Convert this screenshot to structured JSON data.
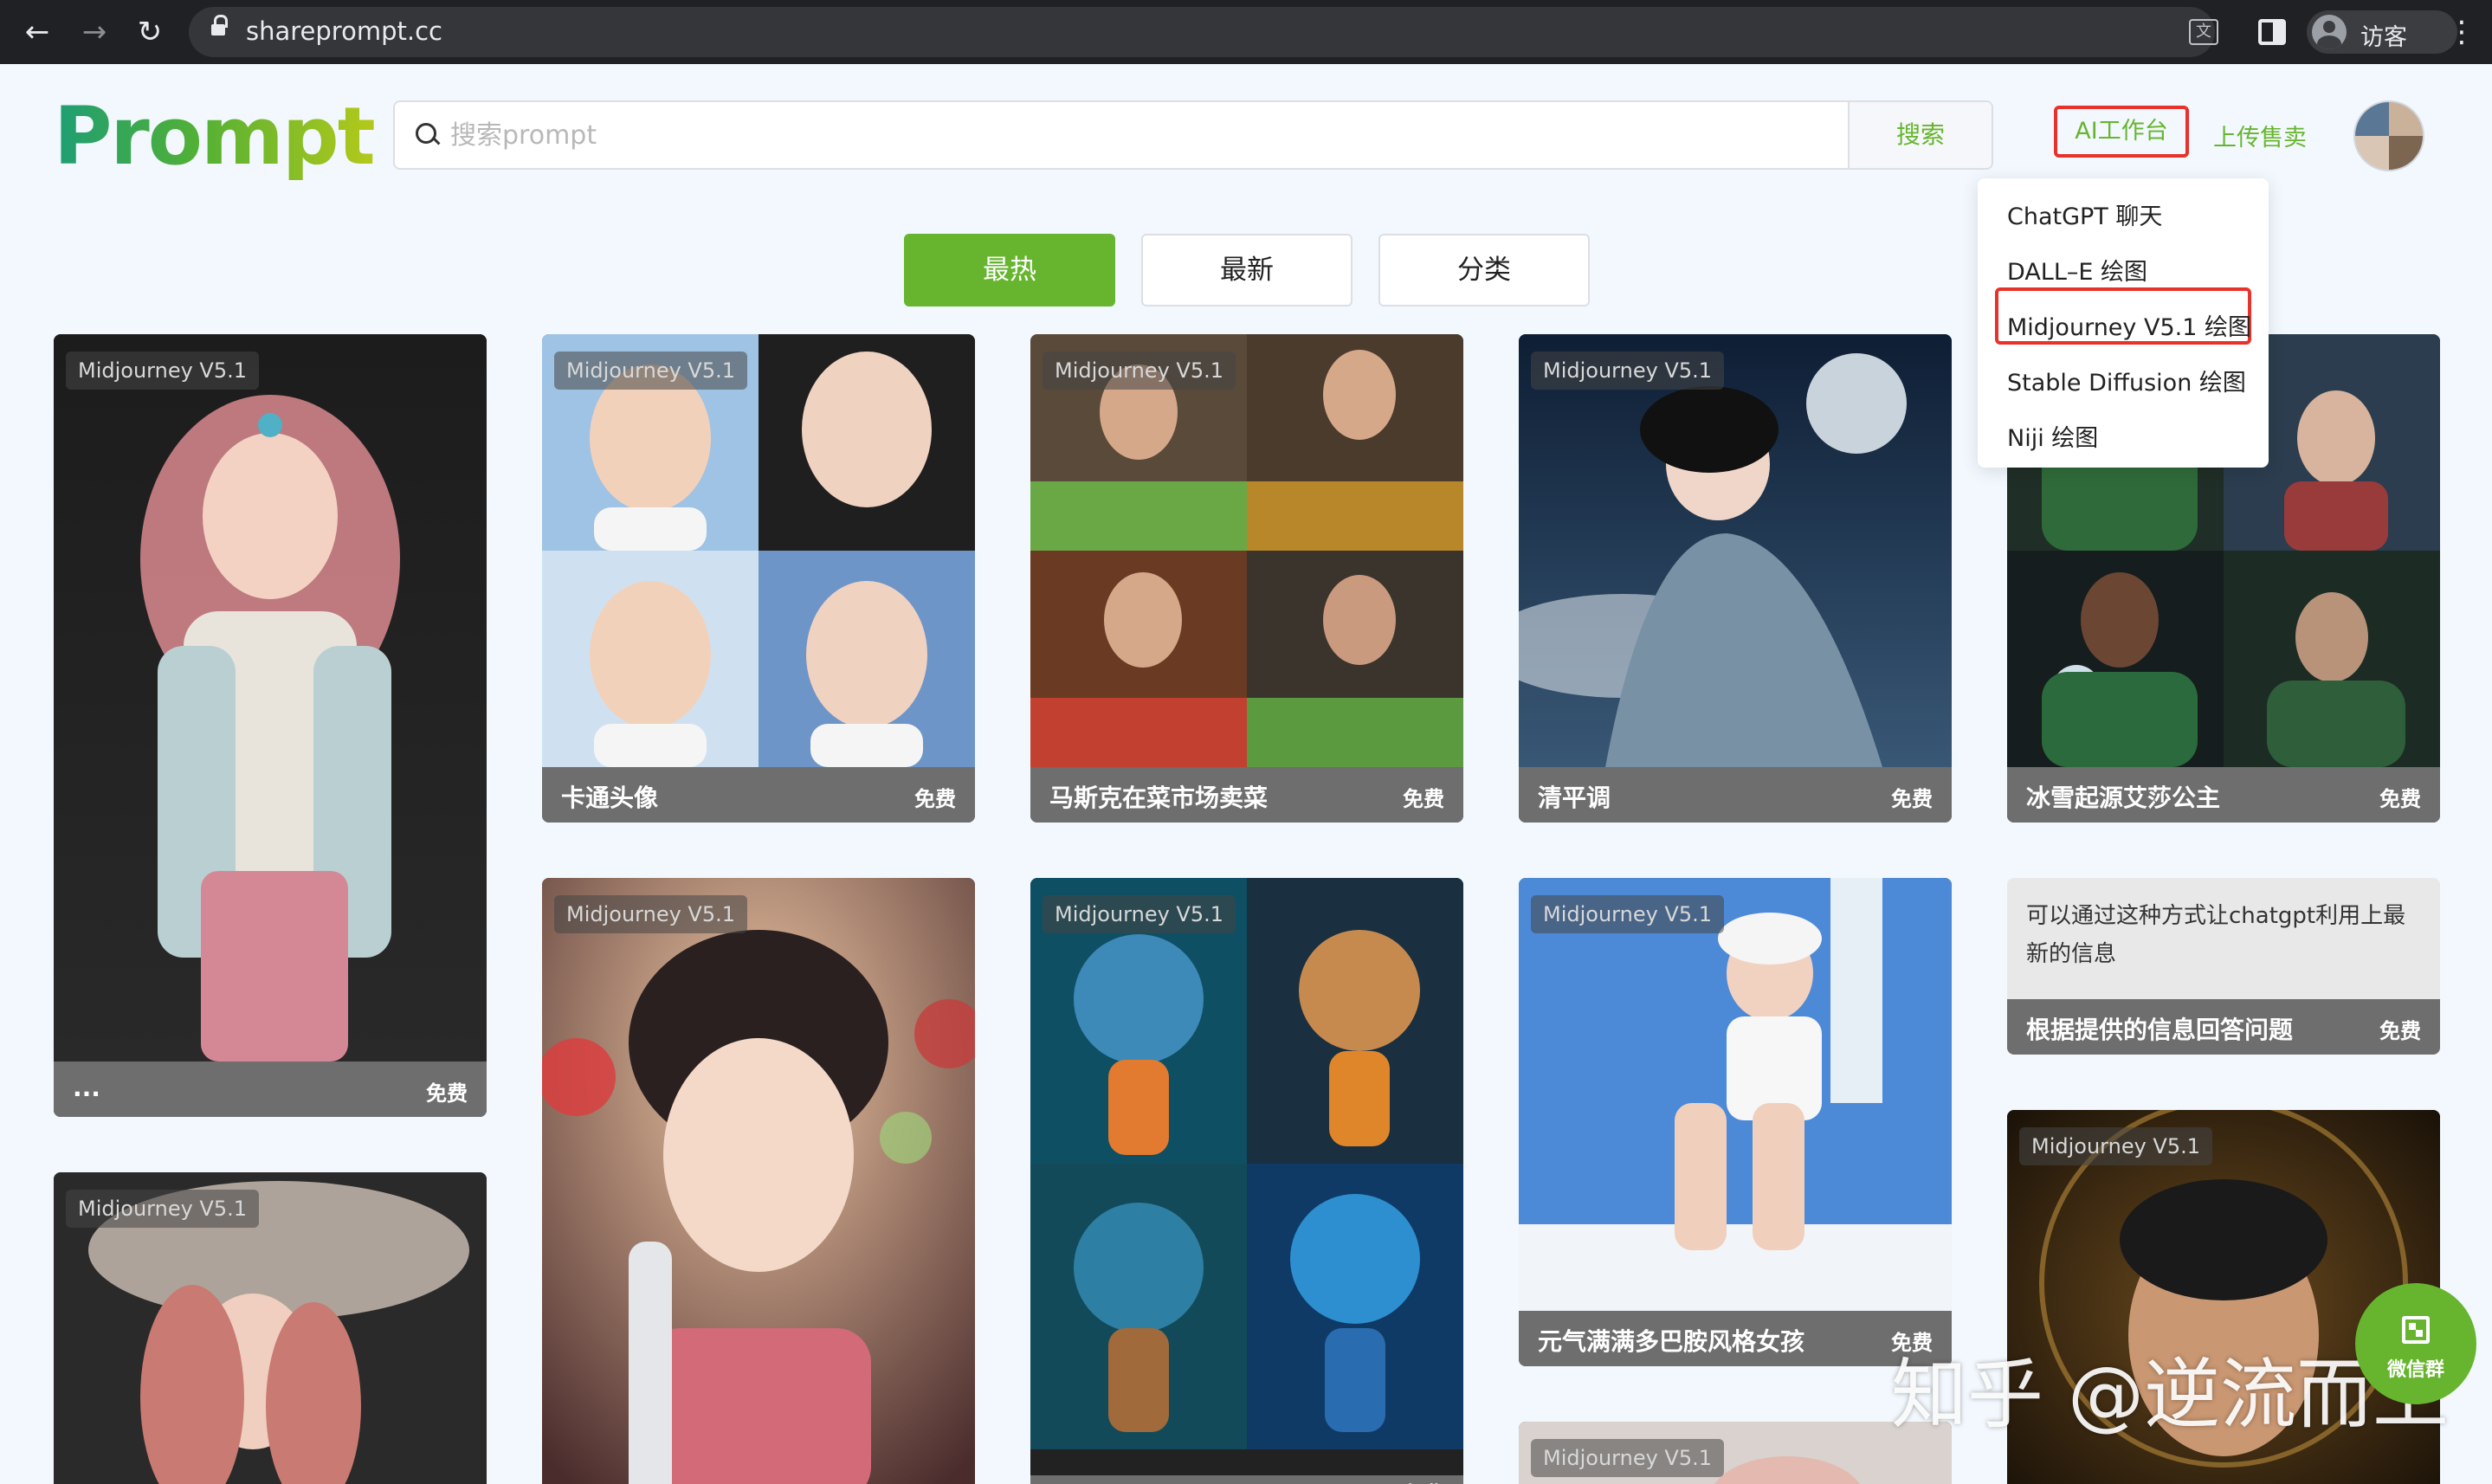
{
  "browser": {
    "url": "shareprompt.cc",
    "profile_name": "访客",
    "back_glyph": "←",
    "forward_glyph": "→",
    "reload_glyph": "↻",
    "menu_glyph": "⋮"
  },
  "header": {
    "logo_text": "Prompt",
    "search_placeholder": "搜索prompt",
    "search_button": "搜索",
    "nav_ai": "AI工作台",
    "nav_upload": "上传售卖"
  },
  "dropdown": {
    "items": [
      "ChatGPT 聊天",
      "DALL–E 绘图",
      "Midjourney V5.1 绘图",
      "Stable Diffusion 绘图",
      "Niji 绘图"
    ],
    "highlighted_index": 2
  },
  "tabs": [
    {
      "label": "最热",
      "active": true
    },
    {
      "label": "最新",
      "active": false
    },
    {
      "label": "分类",
      "active": false
    }
  ],
  "cards": [
    {
      "badge": "Midjourney V5.1",
      "title": "...",
      "price": "免费"
    },
    {
      "badge": "Midjourney V5.1",
      "title": "卡通头像",
      "price": "免费"
    },
    {
      "badge": "Midjourney V5.1",
      "title": "马斯克在菜市场卖菜",
      "price": "免费"
    },
    {
      "badge": "Midjourney V5.1",
      "title": "清平调",
      "price": "免费"
    },
    {
      "badge": "",
      "title": "冰雪起源艾莎公主",
      "price": "免费"
    },
    {
      "badge": "Midjourney V5.1",
      "title": "",
      "price": ""
    },
    {
      "badge": "Midjourney V5.1",
      "title": "",
      "price": ""
    },
    {
      "badge": "Midjourney V5.1",
      "title": "",
      "price": "免费"
    },
    {
      "badge": "Midjourney V5.1",
      "title": "元气满满多巴胺风格女孩",
      "price": "免费"
    },
    {
      "badge": "Midjourney V5.1",
      "title": "",
      "price": ""
    },
    {
      "badge": "Midjourney V5.1",
      "title": "",
      "price": ""
    }
  ],
  "text_card": {
    "description": "可以通过这种方式让chatgpt利用上最新的信息",
    "title": "根据提供的信息回答问题",
    "price": "免费"
  },
  "wechat": {
    "label": "微信群"
  },
  "watermark": "知乎 @逆流而上",
  "colors": {
    "accent": "#67b52e",
    "highlight": "#e8312b"
  }
}
